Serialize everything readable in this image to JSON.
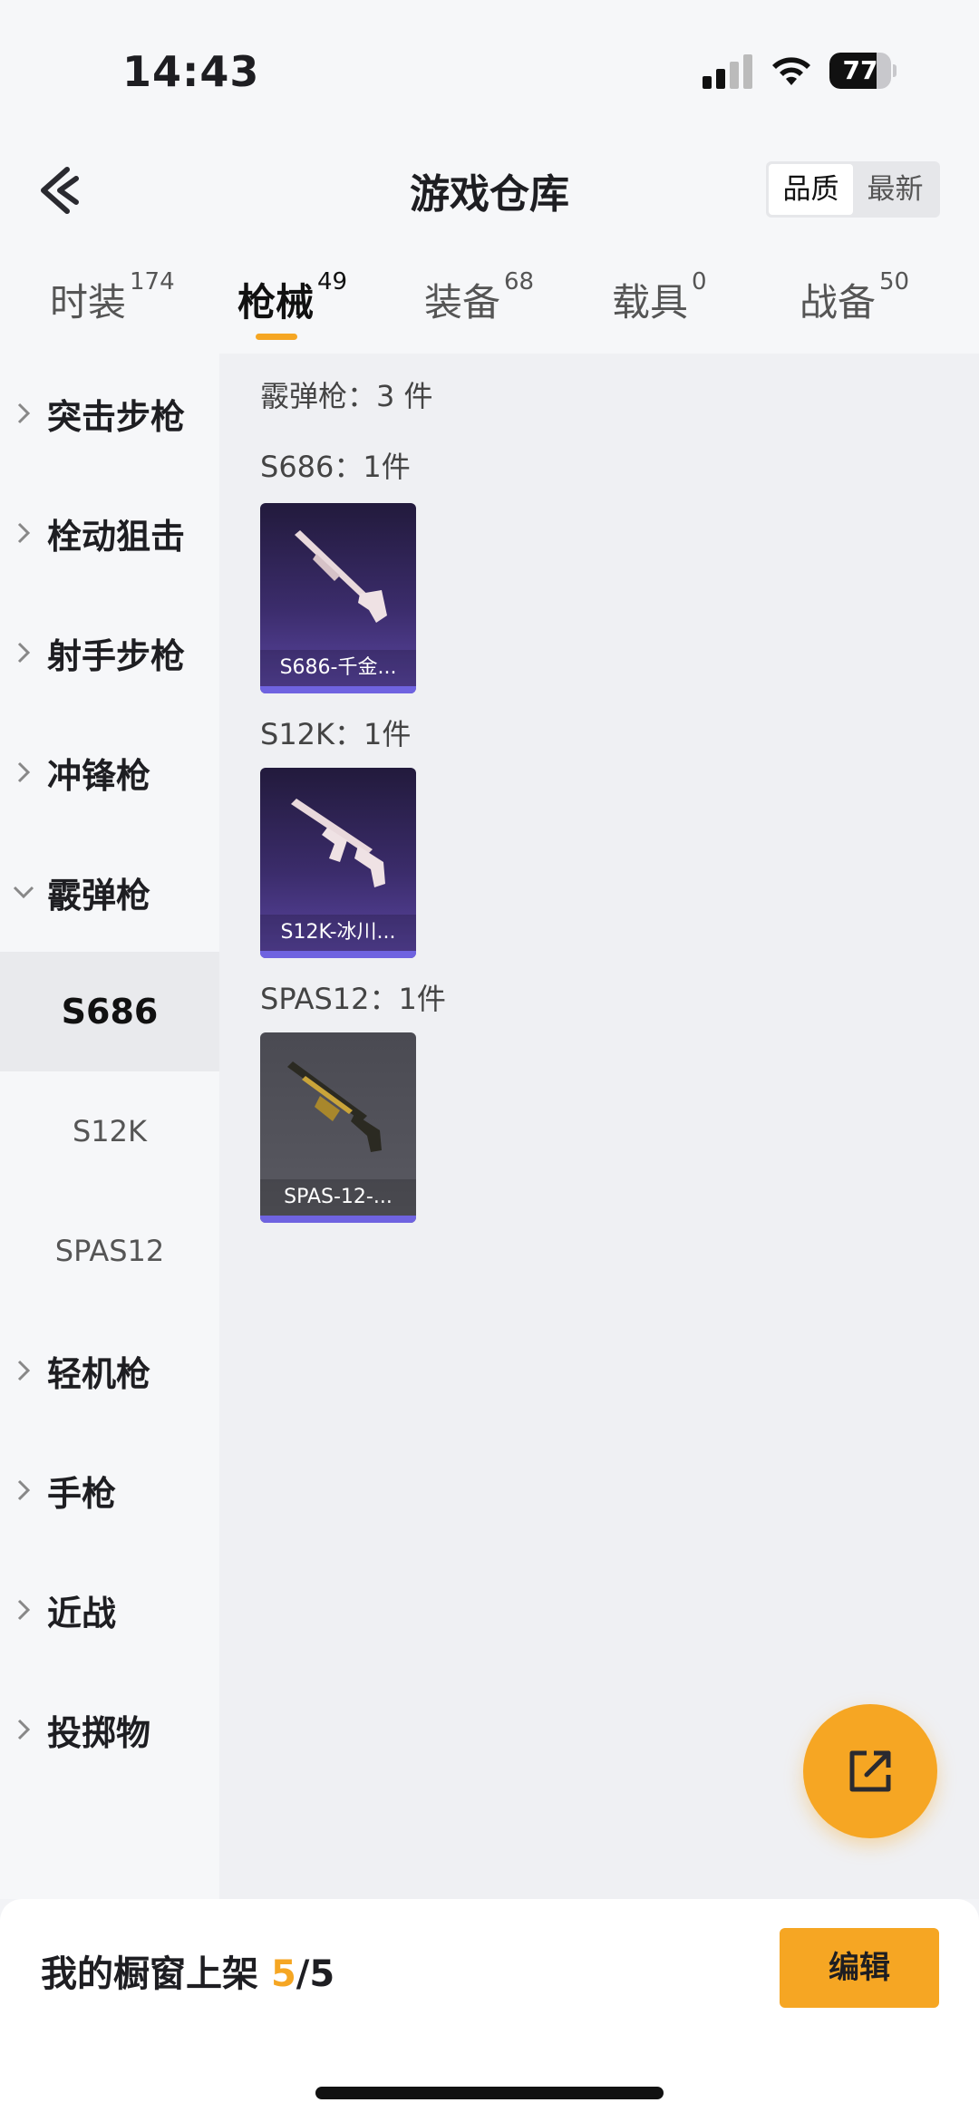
{
  "status": {
    "time": "14:43",
    "battery": "77",
    "battery_level": 0.77
  },
  "header": {
    "title": "游戏仓库",
    "sort_options": [
      "品质",
      "最新"
    ],
    "sort_selected": "品质"
  },
  "tabs": [
    {
      "label": "时装",
      "count": "174"
    },
    {
      "label": "枪械",
      "count": "49",
      "active": true
    },
    {
      "label": "装备",
      "count": "68"
    },
    {
      "label": "载具",
      "count": "0"
    },
    {
      "label": "战备",
      "count": "50"
    }
  ],
  "sidebar": {
    "categories": [
      "突击步枪",
      "栓动狙击",
      "射手步枪",
      "冲锋枪",
      "霰弹枪",
      "轻机枪",
      "手枪",
      "近战",
      "投掷物"
    ],
    "expanded": "霰弹枪",
    "subitems": [
      "S686",
      "S12K",
      "SPAS12"
    ],
    "selected_sub": "S686"
  },
  "content": {
    "summary": "霰弹枪：3 件",
    "groups": [
      {
        "title": "S686：1件",
        "item_name": "S686-千金...",
        "rarity": "purple"
      },
      {
        "title": "S12K：1件",
        "item_name": "S12K-冰川...",
        "rarity": "purple"
      },
      {
        "title": "SPAS12：1件",
        "item_name": "SPAS-12-...",
        "rarity": "gray"
      }
    ]
  },
  "bottom": {
    "label_prefix": "我的橱窗上架 ",
    "shown": "5",
    "label_suffix": "/5",
    "edit_label": "编辑"
  },
  "icons": {
    "back": "chevron-left-icon",
    "share": "share-external-icon",
    "colors": {
      "accent": "#f5a623",
      "purple": "#5b46a3"
    }
  }
}
